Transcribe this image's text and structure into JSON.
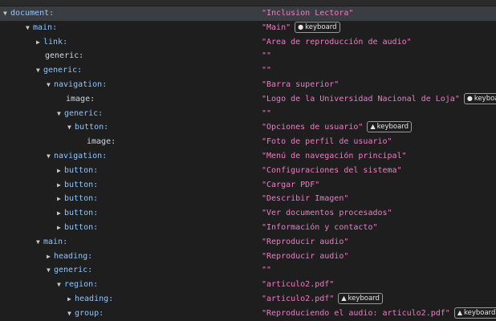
{
  "rows": [
    {
      "key": "document:",
      "value": "\"Inclusion Lectora\""
    },
    {
      "key": "main:",
      "value": "\"Main\"",
      "badge": "keyboard",
      "badge_icon": "info-circle"
    },
    {
      "key": "link:",
      "value": "\"Area de reproducción de audio\""
    },
    {
      "key": "generic:",
      "value": "\"\""
    },
    {
      "key": "generic:",
      "value": "\"\""
    },
    {
      "key": "navigation:",
      "value": "\"Barra superior\""
    },
    {
      "key": "image:",
      "value": "\"Logo de la Universidad Nacional de Loja\"",
      "badge": "keyboard",
      "badge_icon": "info-circle"
    },
    {
      "key": "generic:",
      "value": "\"\""
    },
    {
      "key": "button:",
      "value": "\"Opciones de usuario\"",
      "badge": "keyboard",
      "badge_icon": "warning-triangle"
    },
    {
      "key": "image:",
      "value": "\"Foto de perfil de usuario\""
    },
    {
      "key": "navigation:",
      "value": "\"Menú de navegación principal\""
    },
    {
      "key": "button:",
      "value": "\"Configuraciones del sistema\""
    },
    {
      "key": "button:",
      "value": "\"Cargar PDF\""
    },
    {
      "key": "button:",
      "value": "\"Describir Imagen\""
    },
    {
      "key": "button:",
      "value": "\"Ver documentos procesados\""
    },
    {
      "key": "button:",
      "value": "\"Información y contacto\""
    },
    {
      "key": "main:",
      "value": "\"Reproducir audio\""
    },
    {
      "key": "heading:",
      "value": "\"Reproducir audio\""
    },
    {
      "key": "generic:",
      "value": "\"\""
    },
    {
      "key": "region:",
      "value": "\"articulo2.pdf\""
    },
    {
      "key": "heading:",
      "value": "\"articulo2.pdf\"",
      "badge": "keyboard",
      "badge_icon": "warning-triangle"
    },
    {
      "key": "group:",
      "value": "\"Reproduciendo el audio: articulo2.pdf\"",
      "badge": "keyboard",
      "badge_icon": "warning-triangle"
    }
  ],
  "colors": {
    "background": "#1e1e1e",
    "key": "#8ec5ff",
    "value": "#f07ac8",
    "selected": "#3a3d41"
  }
}
